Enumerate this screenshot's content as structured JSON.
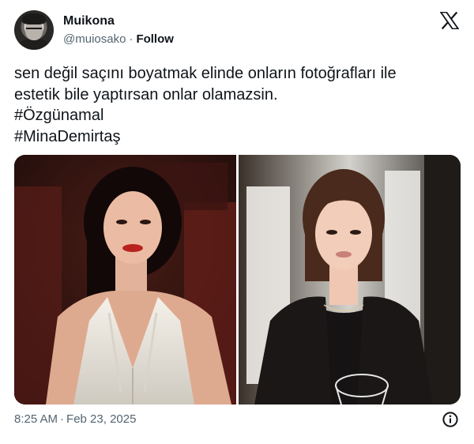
{
  "header": {
    "display_name": "Muikona",
    "handle": "@muiosako",
    "separator": "·",
    "follow_label": "Follow",
    "logo_icon": "x-logo-icon"
  },
  "tweet": {
    "lines": [
      "sen değil saçını boyatmak elinde onların fotoğrafları ile",
      "estetik bile yaptırsan onlar olamazsin.",
      "#Özgünamal",
      "#MinaDemirtaş"
    ]
  },
  "media": {
    "count": 2,
    "images": [
      "photo-woman-white-dress",
      "photo-woman-black-blazer"
    ]
  },
  "footer": {
    "time": "8:25 AM",
    "separator": "·",
    "date": "Feb 23, 2025",
    "info_icon": "info-icon"
  },
  "colors": {
    "text_primary": "#0f1419",
    "text_secondary": "#536471",
    "background": "#ffffff"
  }
}
